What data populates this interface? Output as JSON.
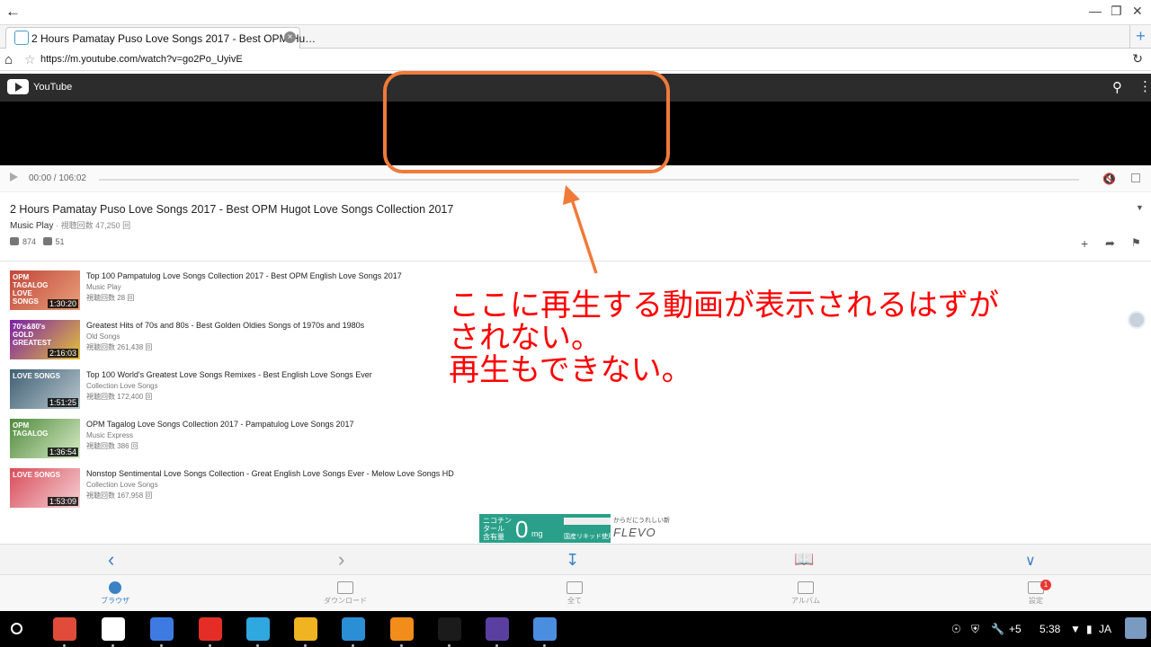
{
  "window": {
    "back_icon": "back-arrow-icon",
    "controls": [
      "minimize-icon",
      "restore-icon",
      "close-icon"
    ]
  },
  "tab": {
    "title": "2 Hours Pamatay Puso Love Songs 2017 - Best OPM Hu…",
    "new_tab": "+"
  },
  "address": {
    "url": "https://m.youtube.com/watch?v=go2Po_UyivE"
  },
  "youtube": {
    "brand": "YouTube"
  },
  "player": {
    "time": "00:00 / 106:02"
  },
  "video": {
    "title": "2 Hours Pamatay Puso Love Songs 2017 - Best OPM Hugot Love Songs Collection 2017",
    "channel": "Music Play",
    "views": "· 視聴回数 47,250 回",
    "likes": "874",
    "dislikes": "51"
  },
  "related": [
    {
      "title": "Top 100 Pampatulog Love Songs Collection 2017 - Best OPM English Love Songs 2017",
      "channel": "Music Play",
      "views": "視聴回数 28 回",
      "duration": "1:30:20",
      "thumb_label": "OPM\nTAGALOG\nLOVE\nSONGS",
      "colors": [
        "#c1463a",
        "#e8a07a"
      ]
    },
    {
      "title": "Greatest Hits of 70s and 80s - Best Golden Oldies Songs of 1970s and 1980s",
      "channel": "Old Songs",
      "views": "視聴回数 261,438 回",
      "duration": "2:16:03",
      "thumb_label": "70's&80's\nGOLD\nGREATEST",
      "colors": [
        "#7a1fa8",
        "#e5c33a"
      ]
    },
    {
      "title": "Top 100 World's Greatest Love Songs Remixes - Best English Love Songs Ever",
      "channel": "Collection Love Songs",
      "views": "視聴回数 172,400 回",
      "duration": "1:51:25",
      "thumb_label": "LOVE SONGS",
      "colors": [
        "#3f5f73",
        "#b9c8cf"
      ]
    },
    {
      "title": "OPM Tagalog Love Songs Collection 2017 - Pampatulog Love Songs 2017",
      "channel": "Music Express",
      "views": "視聴回数 386 回",
      "duration": "1:36:54",
      "thumb_label": "OPM\nTAGALOG",
      "colors": [
        "#4f8a3c",
        "#d9ecc7"
      ]
    },
    {
      "title": "Nonstop Sentimental Love Songs Collection - Great English Love Songs Ever - Melow Love Songs HD",
      "channel": "Collection Love Songs",
      "views": "視聴回数 167,958 回",
      "duration": "1:53:09",
      "thumb_label": "LOVE SONGS",
      "colors": [
        "#d94b58",
        "#f5d3d6"
      ]
    }
  ],
  "ad": {
    "line1": "ニコチン\nタール\n含有量",
    "big": "0",
    "unit": "mg",
    "sub": "国産リキッド使用",
    "tagline": "からだにうれしい新",
    "brand": "FLEVO"
  },
  "annotation": {
    "text_line1": "ここに再生する動画が表示されるはずが",
    "text_line2": "されない。",
    "text_line3": "再生もできない。",
    "color": "#ff0000",
    "box_color": "#f07a3a"
  },
  "bottom_nav": [
    "chevron-left-icon",
    "chevron-right-icon",
    "download-icon",
    "book-icon",
    "chevron-down-icon"
  ],
  "dock": [
    {
      "label": "ブラウザ",
      "icon": "globe-icon",
      "active": true
    },
    {
      "label": "ダウンロード",
      "icon": "folder-download-icon",
      "active": false
    },
    {
      "label": "全て",
      "icon": "folder-icon",
      "active": false
    },
    {
      "label": "アルバム",
      "icon": "list-icon",
      "active": false
    },
    {
      "label": "設定",
      "icon": "gear-icon",
      "active": false,
      "badge": "1"
    }
  ],
  "taskbar": {
    "apps": [
      {
        "name": "chrome-icon",
        "color": "#e04b3a"
      },
      {
        "name": "gmail-icon",
        "color": "#ffffff"
      },
      {
        "name": "docs-icon",
        "color": "#3d7be3"
      },
      {
        "name": "youtube-icon",
        "color": "#e52d27"
      },
      {
        "name": "play-store-icon",
        "color": "#2fa8e0"
      },
      {
        "name": "downloader-icon",
        "color": "#f0b422"
      },
      {
        "name": "es-file-icon",
        "color": "#2b8fd6"
      },
      {
        "name": "vlc-icon",
        "color": "#f28c1a"
      },
      {
        "name": "kindle-icon",
        "color": "#1b1b1b"
      },
      {
        "name": "screen-icon",
        "color": "#5b3fa0"
      },
      {
        "name": "video-dl-icon",
        "color": "#4b8ee0"
      }
    ],
    "notif_count": "+5",
    "clock": "5:38",
    "ime": "JA"
  }
}
